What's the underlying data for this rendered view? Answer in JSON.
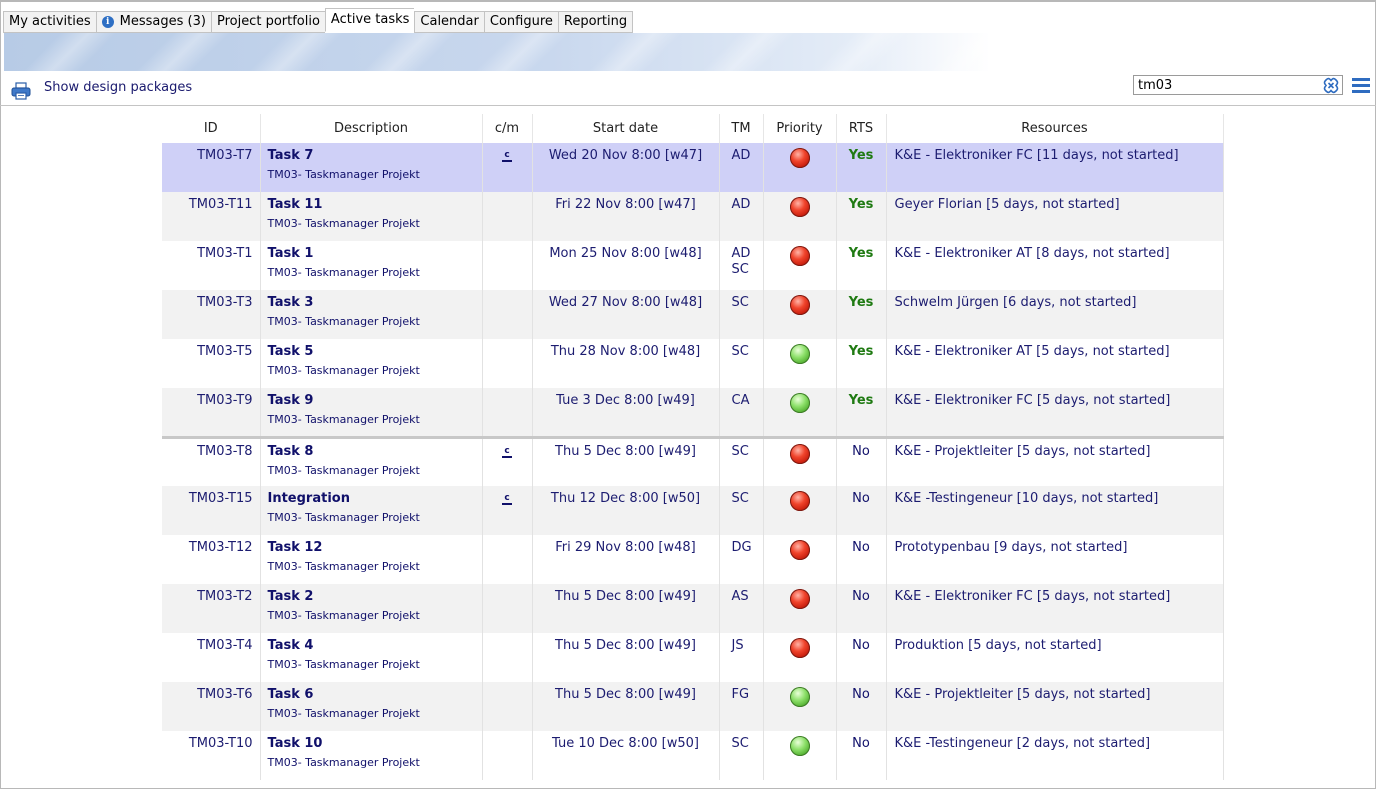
{
  "tabs": [
    {
      "label": "My activities",
      "active": false,
      "icon": null
    },
    {
      "label": "Messages (3)",
      "active": false,
      "icon": "info-icon"
    },
    {
      "label": "Project portfolio",
      "active": false,
      "icon": null
    },
    {
      "label": "Active tasks",
      "active": true,
      "icon": null
    },
    {
      "label": "Calendar",
      "active": false,
      "icon": null
    },
    {
      "label": "Configure",
      "active": false,
      "icon": null
    },
    {
      "label": "Reporting",
      "active": false,
      "icon": null
    }
  ],
  "toolbar": {
    "show_design_packages": "Show design packages",
    "search_value": "tm03"
  },
  "table": {
    "headers": [
      "ID",
      "Description",
      "c/m",
      "Start date",
      "TM",
      "Priority",
      "RTS",
      "Resources"
    ],
    "rows": [
      {
        "id": "TM03-T7",
        "task": "Task 7",
        "project": "TM03- Taskmanager Projekt",
        "cm": "c",
        "start": "Wed 20 Nov 8:00 [w47]",
        "tm": [
          "AD"
        ],
        "priority": "red",
        "rts": "Yes",
        "resources": "K&E - Elektroniker FC [11 days, not started]",
        "selected": true
      },
      {
        "id": "TM03-T11",
        "task": "Task 11",
        "project": "TM03- Taskmanager Projekt",
        "cm": "",
        "start": "Fri 22 Nov 8:00 [w47]",
        "tm": [
          "AD"
        ],
        "priority": "red",
        "rts": "Yes",
        "resources": "Geyer Florian [5 days, not started]"
      },
      {
        "id": "TM03-T1",
        "task": "Task 1",
        "project": "TM03- Taskmanager Projekt",
        "cm": "",
        "start": "Mon 25 Nov 8:00 [w48]",
        "tm": [
          "AD",
          "SC"
        ],
        "priority": "red",
        "rts": "Yes",
        "resources": "K&E - Elektroniker AT [8 days, not started]"
      },
      {
        "id": "TM03-T3",
        "task": "Task 3",
        "project": "TM03- Taskmanager Projekt",
        "cm": "",
        "start": "Wed 27 Nov 8:00 [w48]",
        "tm": [
          "SC"
        ],
        "priority": "red",
        "rts": "Yes",
        "resources": "Schwelm Jürgen [6 days, not started]"
      },
      {
        "id": "TM03-T5",
        "task": "Task 5",
        "project": "TM03- Taskmanager Projekt",
        "cm": "",
        "start": "Thu 28 Nov 8:00 [w48]",
        "tm": [
          "SC"
        ],
        "priority": "green",
        "rts": "Yes",
        "resources": "K&E - Elektroniker AT [5 days, not started]"
      },
      {
        "id": "TM03-T9",
        "task": "Task 9",
        "project": "TM03- Taskmanager Projekt",
        "cm": "",
        "start": "Tue 3 Dec 8:00 [w49]",
        "tm": [
          "CA"
        ],
        "priority": "green",
        "rts": "Yes",
        "resources": "K&E - Elektroniker FC [5 days, not started]",
        "separator": true
      },
      {
        "id": "TM03-T8",
        "task": "Task 8",
        "project": "TM03- Taskmanager Projekt",
        "cm": "c",
        "start": "Thu 5 Dec 8:00 [w49]",
        "tm": [
          "SC"
        ],
        "priority": "red",
        "rts": "No",
        "resources": "K&E - Projektleiter [5 days, not started]"
      },
      {
        "id": "TM03-T15",
        "task": "Integration",
        "project": "TM03- Taskmanager Projekt",
        "cm": "c",
        "start": "Thu 12 Dec 8:00 [w50]",
        "tm": [
          "SC"
        ],
        "priority": "red",
        "rts": "No",
        "resources": "K&E -Testingeneur [10 days, not started]"
      },
      {
        "id": "TM03-T12",
        "task": "Task 12",
        "project": "TM03- Taskmanager Projekt",
        "cm": "",
        "start": "Fri 29 Nov 8:00 [w48]",
        "tm": [
          "DG"
        ],
        "priority": "red",
        "rts": "No",
        "resources": "Prototypenbau [9 days, not started]"
      },
      {
        "id": "TM03-T2",
        "task": "Task 2",
        "project": "TM03- Taskmanager Projekt",
        "cm": "",
        "start": "Thu 5 Dec 8:00 [w49]",
        "tm": [
          "AS"
        ],
        "priority": "red",
        "rts": "No",
        "resources": "K&E - Elektroniker FC [5 days, not started]"
      },
      {
        "id": "TM03-T4",
        "task": "Task 4",
        "project": "TM03- Taskmanager Projekt",
        "cm": "",
        "start": "Thu 5 Dec 8:00 [w49]",
        "tm": [
          "JS"
        ],
        "priority": "red",
        "rts": "No",
        "resources": "Produktion [5 days, not started]"
      },
      {
        "id": "TM03-T6",
        "task": "Task 6",
        "project": "TM03- Taskmanager Projekt",
        "cm": "",
        "start": "Thu 5 Dec 8:00 [w49]",
        "tm": [
          "FG"
        ],
        "priority": "green",
        "rts": "No",
        "resources": "K&E - Projektleiter [5 days, not started]"
      },
      {
        "id": "TM03-T10",
        "task": "Task 10",
        "project": "TM03- Taskmanager Projekt",
        "cm": "",
        "start": "Tue 10 Dec 8:00 [w50]",
        "tm": [
          "SC"
        ],
        "priority": "green",
        "rts": "No",
        "resources": "K&E -Testingeneur [2 days, not started]"
      }
    ]
  }
}
